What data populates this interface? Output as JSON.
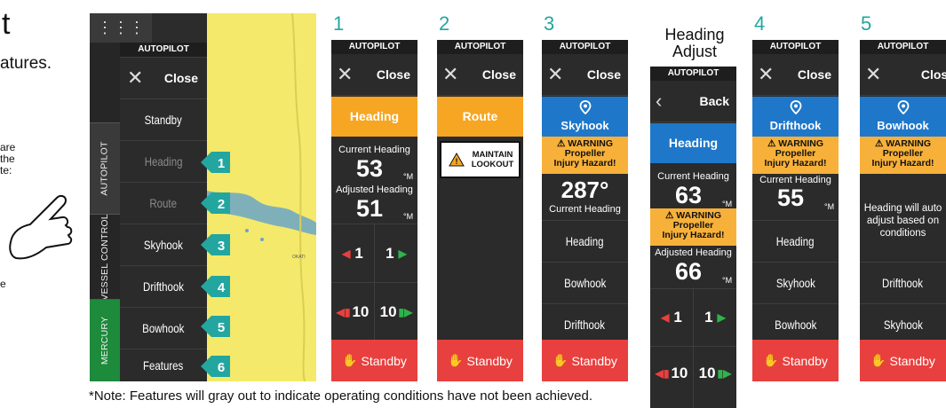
{
  "intro": {
    "title_fragment": "t",
    "features_fragment": "atures.",
    "side_lines": [
      "are",
      "the",
      "te:"
    ],
    "side_tail": "e"
  },
  "device": {
    "grid_icon": "grid-icon",
    "vertical_tabs": [
      "AUTOPILOT",
      "VESSEL CONTROL",
      "MERCURY"
    ],
    "menu_header": "AUTOPILOT",
    "menu_items": [
      "Close",
      "Standby",
      "Heading",
      "Route",
      "Skyhook",
      "Drifthook",
      "Bowhook",
      "Features"
    ],
    "callouts": [
      "1",
      "2",
      "3",
      "4",
      "5",
      "6"
    ],
    "map_label": "OKATI"
  },
  "step_numbers": [
    "1",
    "2",
    "3",
    "4",
    "5"
  ],
  "heading_adjust_title": [
    "Heading",
    "Adjust"
  ],
  "panels": {
    "p1": {
      "header": "AUTOPILOT",
      "close": "Close",
      "mode": "Heading",
      "current_label": "Current Heading",
      "current_value": "53",
      "unit": "°M",
      "adjusted_label": "Adjusted Heading",
      "adjusted_value": "51",
      "steps": [
        "1",
        "1",
        "10",
        "10"
      ],
      "standby": "Standby"
    },
    "p2": {
      "header": "AUTOPILOT",
      "close": "Close",
      "mode": "Route",
      "warning": [
        "MAINTAIN",
        "LOOKOUT"
      ],
      "standby": "Standby"
    },
    "p3": {
      "header": "AUTOPILOT",
      "close": "Close",
      "mode": "Skyhook",
      "warning_title": "WARNING",
      "warning_lines": [
        "Propeller",
        "Injury Hazard!"
      ],
      "heading_value": "287°",
      "heading_label": "Current Heading",
      "items": [
        "Heading",
        "Bowhook",
        "Drifthook"
      ],
      "standby": "Standby"
    },
    "adj": {
      "header": "AUTOPILOT",
      "back": "Back",
      "mode": "Heading",
      "current_label": "Current Heading",
      "current_value": "63",
      "unit": "°M",
      "warning_title": "WARNING",
      "warning_lines": [
        "Propeller",
        "Injury Hazard!"
      ],
      "adjusted_label": "Adjusted Heading",
      "adjusted_value": "66",
      "steps": [
        "1",
        "1",
        "10",
        "10"
      ]
    },
    "p4": {
      "header": "AUTOPILOT",
      "close": "Close",
      "mode": "Drifthook",
      "warning_title": "WARNING",
      "warning_lines": [
        "Propeller",
        "Injury Hazard!"
      ],
      "current_label": "Current Heading",
      "current_value": "55",
      "unit": "°M",
      "items": [
        "Heading",
        "Skyhook",
        "Bowhook"
      ],
      "standby": "Standby"
    },
    "p5": {
      "header": "AUTOPILOT",
      "close": "Close",
      "mode": "Bowhook",
      "warning_title": "WARNING",
      "warning_lines": [
        "Propeller",
        "Injury Hazard!"
      ],
      "info": [
        "Heading will auto",
        "adjust based on",
        "conditions"
      ],
      "items": [
        "Drifthook",
        "Skyhook"
      ],
      "standby": "Standby"
    }
  },
  "note": "*Note: Features will gray out to indicate operating conditions have not been achieved.",
  "colors": {
    "teal": "#23a6a0",
    "orange": "#f6a623",
    "blue": "#1f77c9",
    "red": "#e8403e",
    "map": "#f4e96a"
  }
}
